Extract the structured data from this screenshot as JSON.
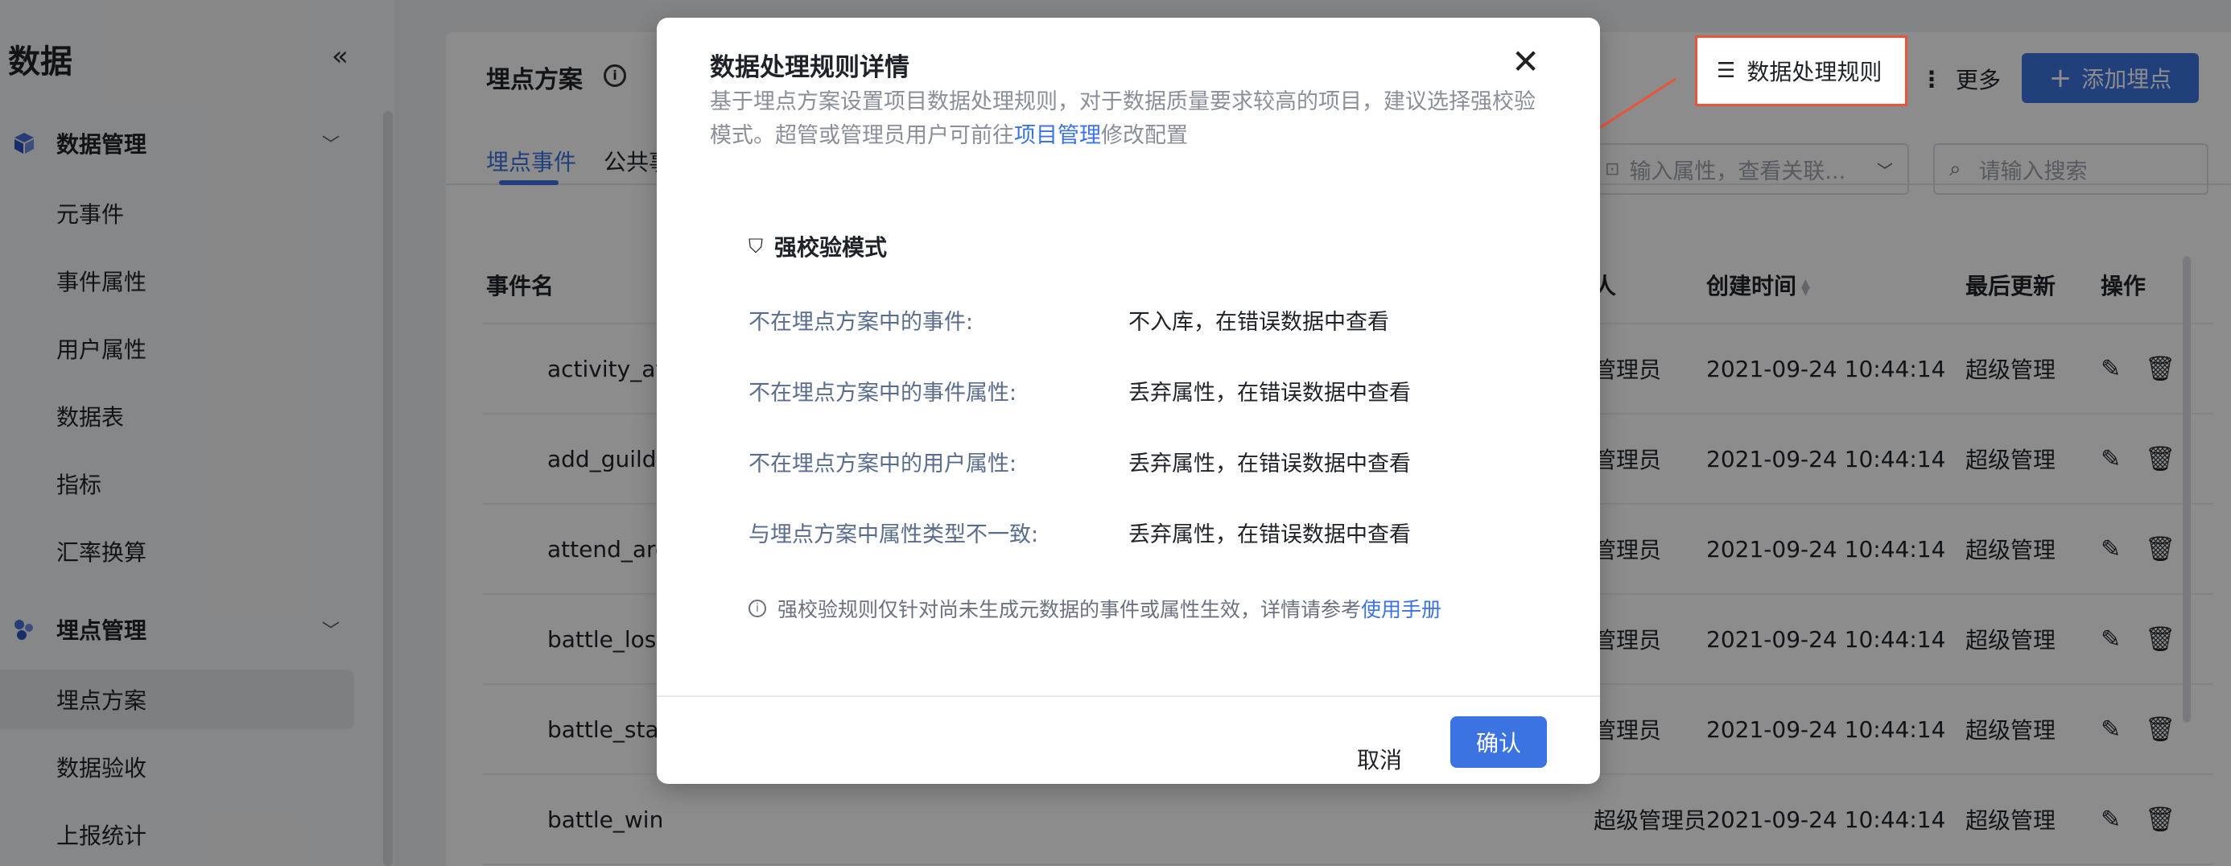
{
  "sidebar": {
    "title": "数据",
    "collapse_icon": "«",
    "groups": [
      {
        "label": "数据管理",
        "items": [
          "元事件",
          "事件属性",
          "用户属性",
          "数据表",
          "指标",
          "汇率换算"
        ]
      },
      {
        "label": "埋点管理",
        "items": [
          "埋点方案",
          "数据验收",
          "上报统计"
        ]
      }
    ],
    "active_item": "埋点方案"
  },
  "header": {
    "title": "埋点方案",
    "rule_button": "数据处理规则",
    "more_button": "更多",
    "add_button": "添加埋点"
  },
  "tabs": [
    "埋点事件",
    "公共事"
  ],
  "filters": {
    "select_placeholder": "输入属性，查看关联...",
    "search_placeholder": "请输入搜索"
  },
  "table": {
    "columns": [
      "事件名",
      "人",
      "创建时间",
      "最后更新",
      "操作"
    ],
    "rows": [
      {
        "name": "activity_att",
        "creator": "管理员",
        "created": "2021-09-24 10:44:14",
        "updater": "超级管理"
      },
      {
        "name": "add_guild",
        "creator": "管理员",
        "created": "2021-09-24 10:44:14",
        "updater": "超级管理"
      },
      {
        "name": "attend_are",
        "creator": "管理员",
        "created": "2021-09-24 10:44:14",
        "updater": "超级管理"
      },
      {
        "name": "battle_lost",
        "creator": "管理员",
        "created": "2021-09-24 10:44:14",
        "updater": "超级管理"
      },
      {
        "name": "battle_star",
        "creator": "管理员",
        "created": "2021-09-24 10:44:14",
        "updater": "超级管理"
      },
      {
        "name": "battle_win",
        "creator": "超级管理员",
        "created": "2021-09-24 10:44:14",
        "updater": "超级管理"
      }
    ]
  },
  "modal": {
    "title": "数据处理规则详情",
    "desc_part1": "基于埋点方案设置项目数据处理规则，对于数据质量要求较高的项目，建议选择强校验模式。超管或管理员用户可前往",
    "desc_link": "项目管理",
    "desc_part2": "修改配置",
    "mode_title": "强校验模式",
    "rules": [
      {
        "key": "不在埋点方案中的事件:",
        "value": "不入库，在错误数据中查看"
      },
      {
        "key": "不在埋点方案中的事件属性:",
        "value": "丢弃属性，在错误数据中查看"
      },
      {
        "key": "不在埋点方案中的用户属性:",
        "value": "丢弃属性，在错误数据中查看"
      },
      {
        "key": "与埋点方案中属性类型不一致:",
        "value": "丢弃属性，在错误数据中查看"
      }
    ],
    "note_text": "强校验规则仅针对尚未生成元数据的事件或属性生效，详情请参考",
    "note_link": "使用手册",
    "cancel_label": "取消",
    "ok_label": "确认"
  },
  "colors": {
    "accent": "#3b73e0",
    "highlight": "#e8553a"
  }
}
